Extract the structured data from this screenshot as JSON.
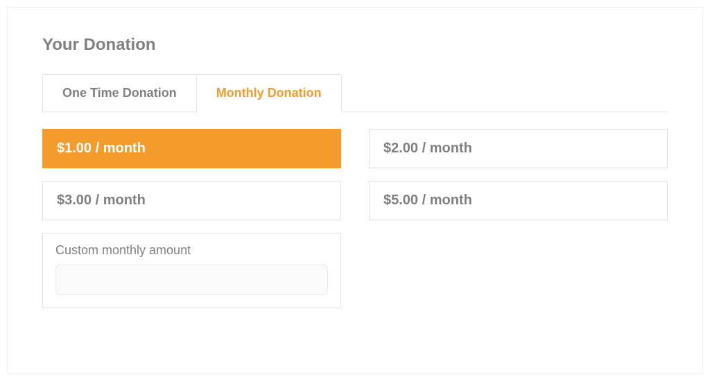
{
  "heading": "Your Donation",
  "tabs": [
    {
      "label": "One Time Donation",
      "active": false
    },
    {
      "label": "Monthly Donation",
      "active": true
    }
  ],
  "amounts": [
    {
      "label": "$1.00 / month",
      "selected": true
    },
    {
      "label": "$2.00 / month",
      "selected": false
    },
    {
      "label": "$3.00 / month",
      "selected": false
    },
    {
      "label": "$5.00 / month",
      "selected": false
    }
  ],
  "custom": {
    "label": "Custom monthly amount",
    "value": ""
  },
  "colors": {
    "accent": "#f39c2c",
    "muted_text": "#808080",
    "border": "#e5e5e5"
  }
}
